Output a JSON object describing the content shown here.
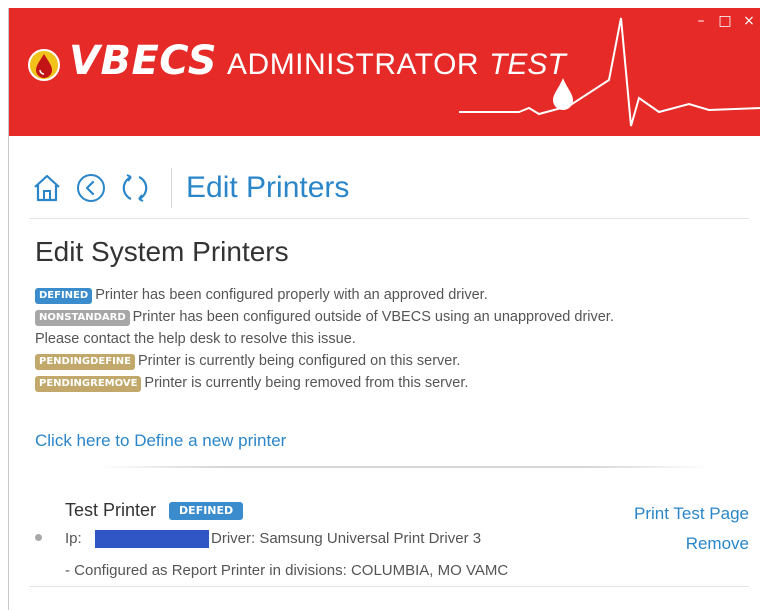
{
  "window": {
    "brand": "VBECS",
    "app_name": "ADMINISTRATOR",
    "environment": "TEST",
    "controls": {
      "minimize": "–",
      "maximize": "□",
      "close": "×"
    }
  },
  "toolbar": {
    "page_title": "Edit Printers",
    "icons": [
      "home-icon",
      "back-icon",
      "refresh-icon"
    ]
  },
  "content": {
    "section_title": "Edit System Printers",
    "legend": [
      {
        "badge": "DEFINED",
        "color": "#3a8ccc",
        "text": "Printer has been configured properly with an approved driver."
      },
      {
        "badge": "NONSTANDARD",
        "color": "#a7a7a7",
        "text": "Printer has been configured outside of VBECS using an unapproved driver.",
        "text2": "Please contact the help desk to resolve this issue."
      },
      {
        "badge": "PENDINGDEFINE",
        "color": "#c2a96b",
        "text": "Printer is currently being configured on this server."
      },
      {
        "badge": "PENDINGREMOVE",
        "color": "#c2a96b",
        "text": "Printer is currently being removed from this server."
      }
    ],
    "define_link": "Click here to Define a new printer"
  },
  "printers": [
    {
      "name": "Test Printer",
      "status": "DEFINED",
      "ip_label": "Ip:",
      "driver": "Driver: Samsung Universal Print Driver 3",
      "config": "- Configured as Report Printer in divisions: COLUMBIA, MO VAMC",
      "actions": {
        "print_test": "Print Test Page",
        "remove": "Remove"
      }
    }
  ],
  "colors": {
    "header_red": "#e52a27",
    "link_blue": "#2a86c8"
  }
}
